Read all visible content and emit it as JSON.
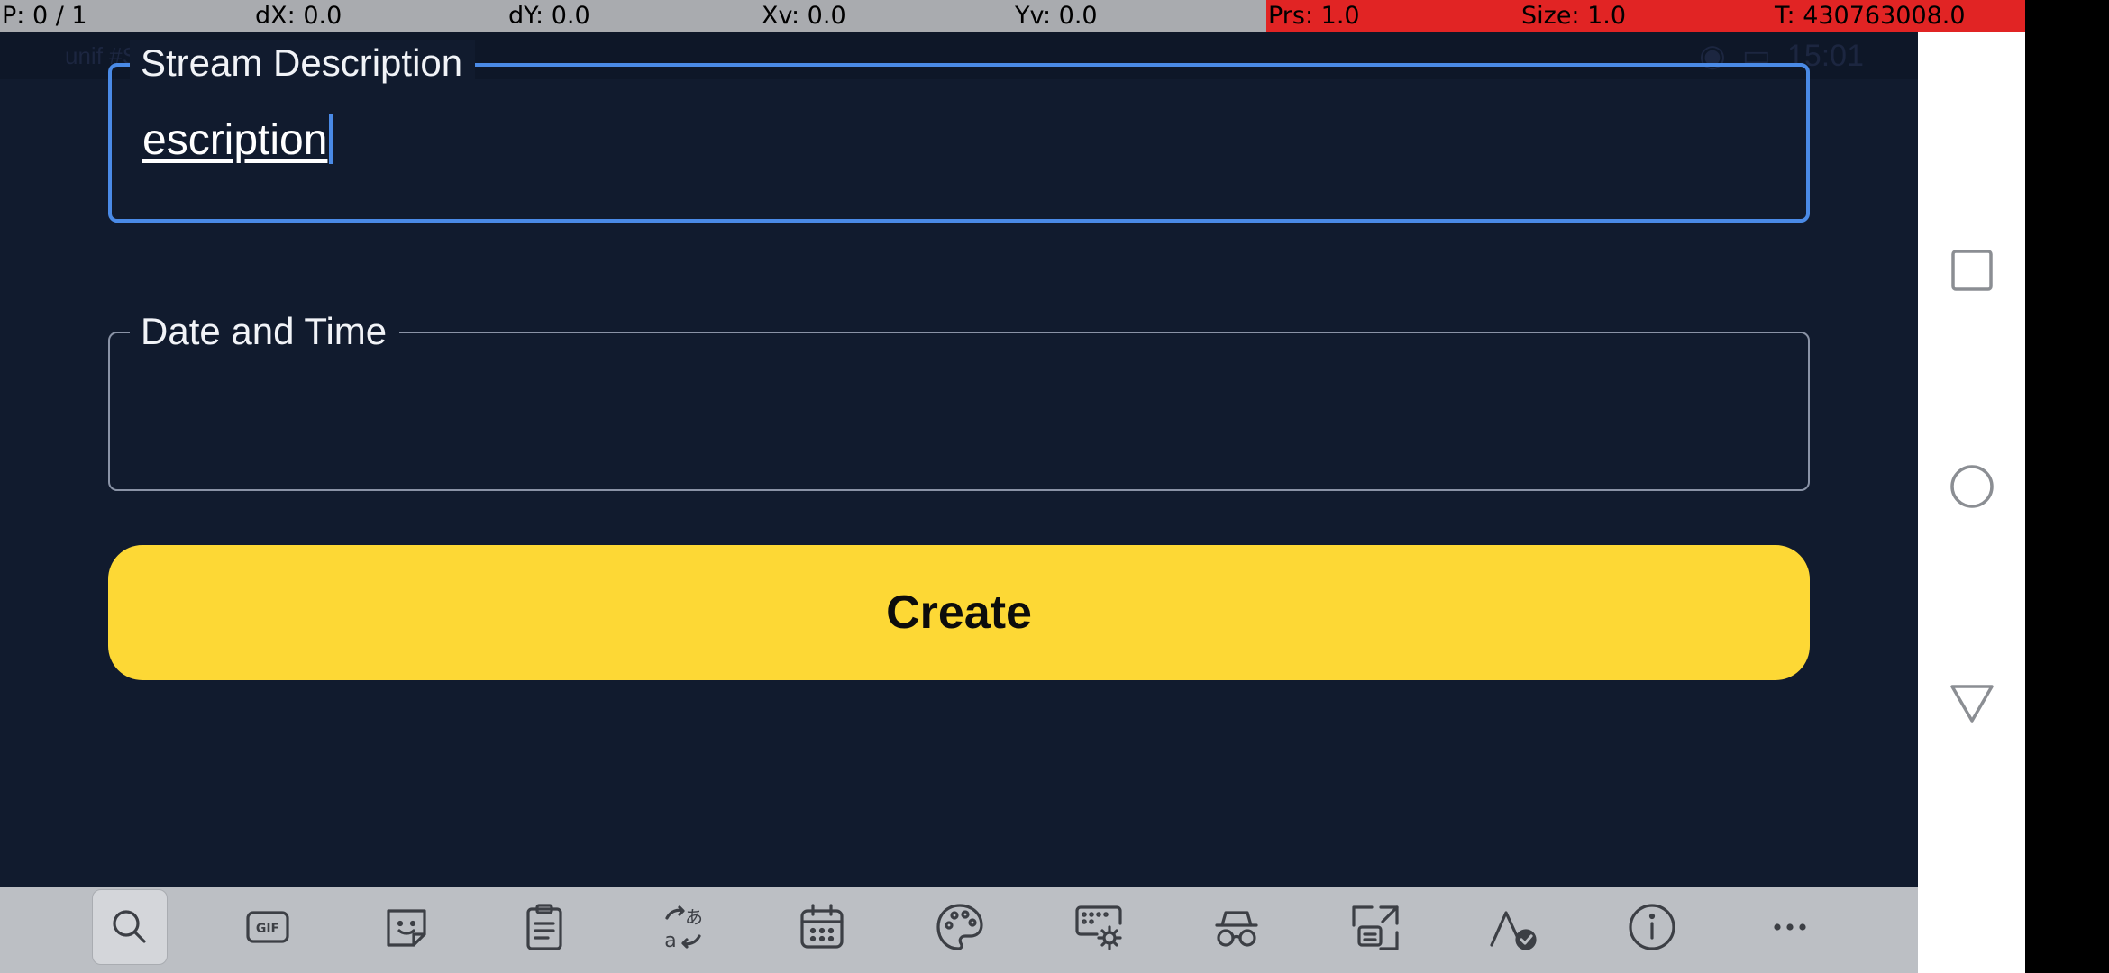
{
  "debug_overlay": {
    "p": "P: 0 / 1",
    "dx": "dX: 0.0",
    "dy": "dY: 0.0",
    "xv": "Xv: 0.0",
    "yv": "Yv: 0.0",
    "prs": "Prs: 1.0",
    "size": "Size: 1.0",
    "t": "T: 430763008.0"
  },
  "status_bar": {
    "left_text": "unif #StaySafe",
    "time": "15:01"
  },
  "form": {
    "description_label": "Stream Description",
    "description_value": "escription",
    "datetime_label": "Date  and Time",
    "datetime_value": "",
    "create_label": "Create"
  },
  "keyboard_toolbar": {
    "tools": [
      "search-icon",
      "gif-icon",
      "sticker-icon",
      "clipboard-icon",
      "translate-icon",
      "calendar-icon",
      "palette-icon",
      "keyboard-settings-icon",
      "incognito-icon",
      "resize-icon",
      "handwriting-icon",
      "info-icon",
      "more-icon"
    ],
    "active": "search-icon"
  },
  "colors": {
    "background": "#111b2e",
    "accent": "#4a8ae6",
    "button": "#fdd835",
    "toolbar": "#bcbfc4"
  }
}
